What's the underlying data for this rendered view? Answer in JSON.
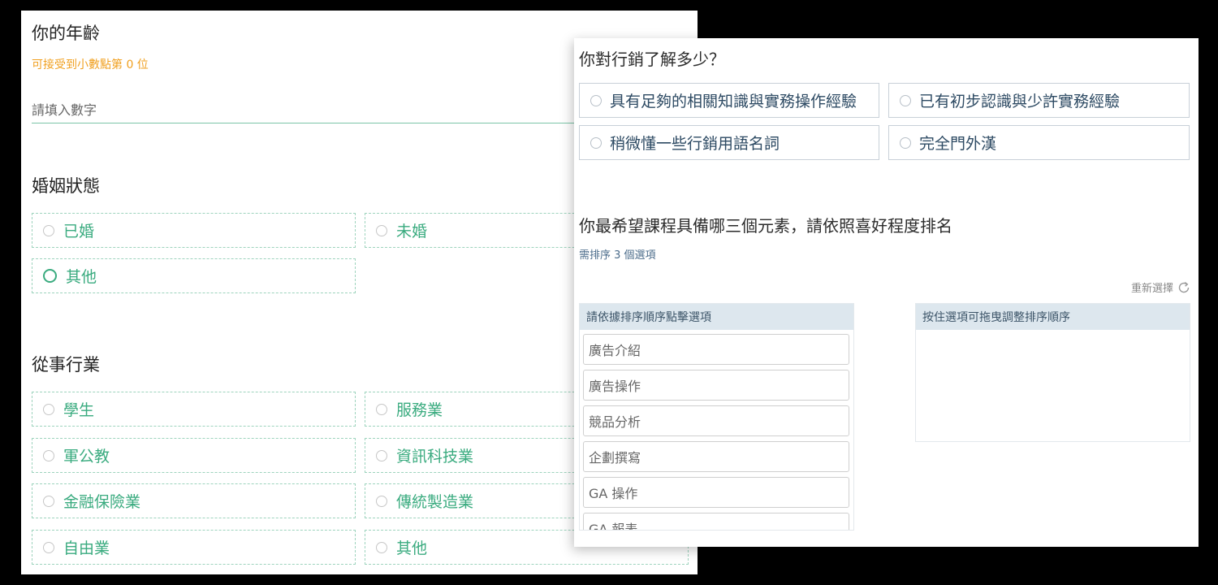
{
  "age": {
    "title": "你的年齡",
    "hint": "可接受到小數點第 0 位",
    "placeholder": "請填入數字"
  },
  "marital": {
    "title": "婚姻狀態",
    "options": [
      "已婚",
      "未婚",
      "其他"
    ]
  },
  "industry": {
    "title": "從事行業",
    "options": [
      "學生",
      "服務業",
      "軍公教",
      "資訊科技業",
      "金融保險業",
      "傳統製造業",
      "自由業",
      "其他"
    ]
  },
  "marketing": {
    "title": "你對行銷了解多少？",
    "options": [
      "具有足夠的相關知識與實務操作經驗",
      "已有初步認識與少許實務經驗",
      "稍微懂一些行銷用語名詞",
      "完全門外漢"
    ]
  },
  "ranking": {
    "title": "你最希望課程具備哪三個元素，請依照喜好程度排名",
    "hint": "需排序 3 個選項",
    "reset_label": "重新選擇",
    "left_header": "請依據排序順序點擊選項",
    "right_header": "按住選項可拖曳調整排序順序",
    "items": [
      "廣告介紹",
      "廣告操作",
      "競品分析",
      "企劃撰寫",
      "GA 操作",
      "GA 報表"
    ]
  },
  "colors": {
    "green": "#3aab7f",
    "orange": "#f0a020",
    "navy": "#2d4a63",
    "header_bg": "#dde7ee"
  },
  "icons": [
    "radio-icon",
    "refresh-icon"
  ]
}
